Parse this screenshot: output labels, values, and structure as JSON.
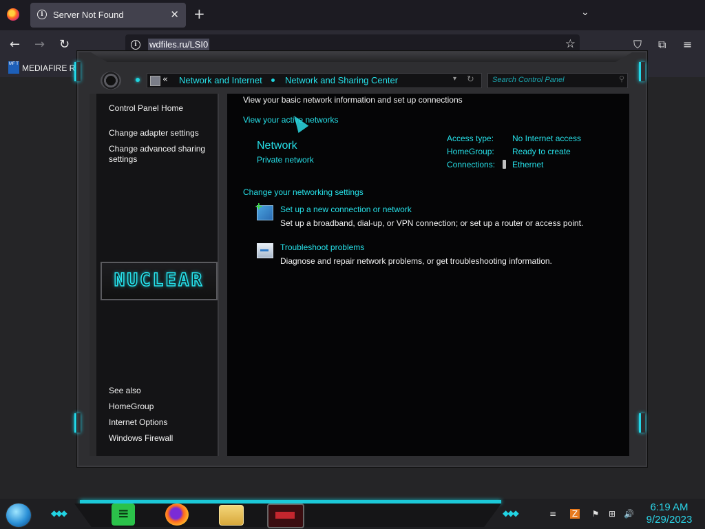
{
  "browser": {
    "tab_title": "Server Not Found",
    "url": "wdfiles.ru/LSI0",
    "bookmark_icon_text": "MF T",
    "bookmark_label": "MEDIAFIRE RO"
  },
  "control_panel": {
    "breadcrumbs": [
      "Network and Internet",
      "Network and Sharing Center"
    ],
    "back_glyph": "«",
    "search_placeholder": "Search Control Panel",
    "left_links": [
      "Control Panel Home",
      "Change adapter settings",
      "Change advanced sharing settings"
    ],
    "see_also_label": "See also",
    "see_also_links": [
      "HomeGroup",
      "Internet Options",
      "Windows Firewall"
    ],
    "banner_text": "NUCLEAR",
    "heading": "View your basic network information and set up connections",
    "active_networks_link": "View your active networks",
    "network_name": "Network",
    "network_type": "Private network",
    "access_type_label": "Access type:",
    "access_type_value": "No Internet access",
    "homegroup_label": "HomeGroup:",
    "homegroup_value": "Ready to create",
    "connections_label": "Connections:",
    "connections_value": "Ethernet",
    "change_settings_heading": "Change your networking settings",
    "tasks": [
      {
        "title": "Set up a new connection or network",
        "desc": "Set up a broadband, dial-up, or VPN connection; or set up a router or access point."
      },
      {
        "title": "Troubleshoot problems",
        "desc": "Diagnose and repair network problems, or get troubleshooting information."
      }
    ]
  },
  "taskbar": {
    "time": "6:19 AM",
    "date": "9/29/2023",
    "apps": [
      "spotify-icon",
      "firefox-icon",
      "file-explorer-icon",
      "game-icon"
    ]
  },
  "colors": {
    "accent": "#26e0e8",
    "window_bg": "#050506",
    "chrome_bg": "#2b2a33"
  }
}
